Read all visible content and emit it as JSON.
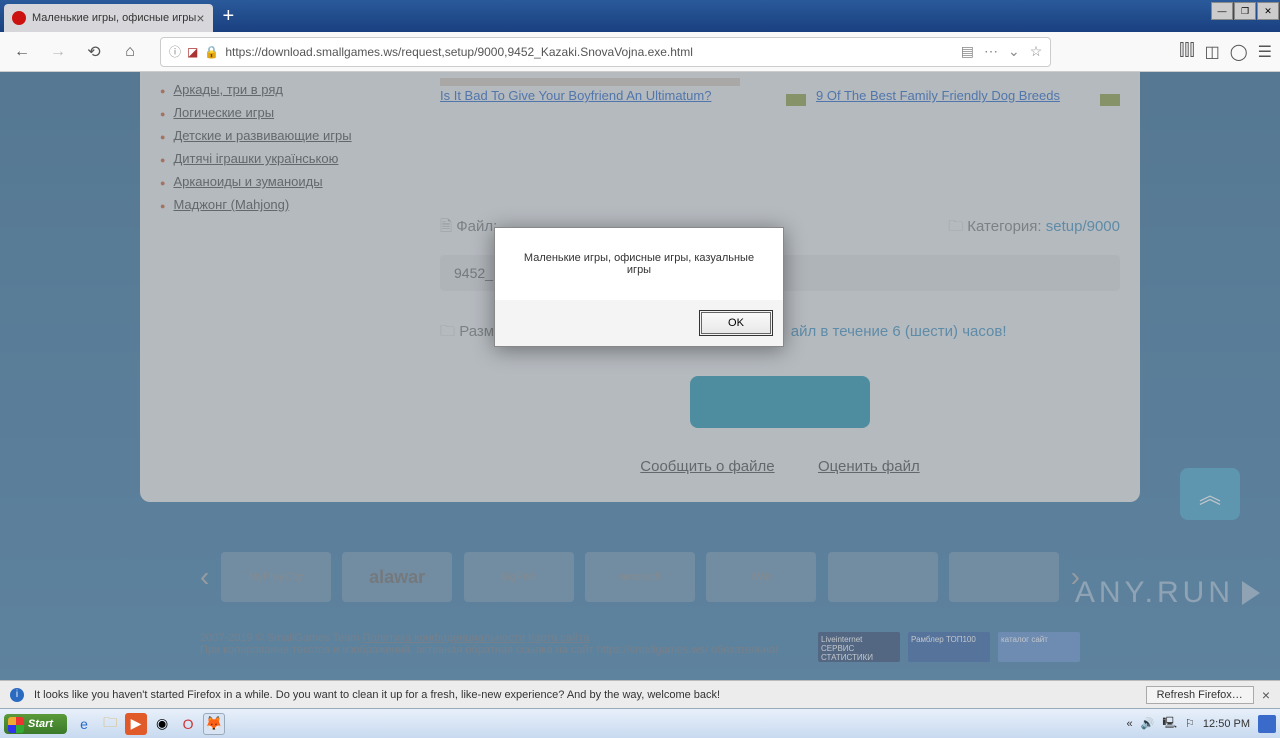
{
  "tab": {
    "title": "Маленькие игры, офисные игры"
  },
  "url": "https://download.smallgames.ws/request,setup/9000,9452_Kazaki.SnovaVojna.exe.html",
  "sidebar": {
    "items": [
      "Аркады, три в ряд",
      "Логические игры",
      "Детские и развивающие игры",
      "Дитячі іграшки українською",
      "Арканоиды и зуманоиды",
      "Маджонг (Mahjong)"
    ]
  },
  "ads": {
    "left": "Is It Bad To Give Your Boyfriend An Ultimatum?",
    "right": "9 Of The Best Family Friendly Dog Breeds"
  },
  "file": {
    "label": "Файл:",
    "name": "9452_Kazaki.SnovaVojna.exe",
    "cat_label": "Категория:",
    "cat_value": "setup/9000",
    "size_label": "Разме",
    "wait_text": "айл в течение 6 (шести) часов!",
    "report": "Сообщить о файле",
    "rate": "Оценить файл"
  },
  "modal": {
    "message": "Маленькие игры, офисные игры, казуальные игры",
    "ok": "OK"
  },
  "footer": {
    "logos": [
      "MyPlayCity",
      "alawar",
      "BigFish",
      "nevosoft",
      "iWin",
      "",
      ""
    ],
    "copyright": "2007-2019 © SmallGames Team",
    "privacy": "Политика конфиденциальности",
    "sitemap": "Карта сайта",
    "note": "При копирование текстов и изображений, активная обратная ссылка на сайт https://smallgames.ws/ обязательна!",
    "badges": [
      "Liveinternet СЕРВИС СТАТИСТИКИ",
      "Рамблер ТОП100",
      "каталог сайт"
    ]
  },
  "infobar": {
    "text": "It looks like you haven't started Firefox in a while. Do you want to clean it up for a fresh, like-new experience? And by the way, welcome back!",
    "refresh": "Refresh Firefox…"
  },
  "taskbar": {
    "start": "Start",
    "clock": "12:50 PM"
  },
  "watermark": "ANY.RUN"
}
